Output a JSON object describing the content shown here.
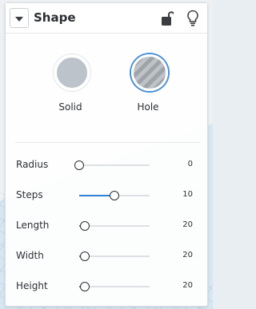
{
  "panel": {
    "title": "Shape",
    "icons": {
      "collapse": "chevron-down-icon",
      "lock": "unlock-icon",
      "bulb": "lightbulb-icon"
    }
  },
  "shape_types": [
    {
      "label": "Solid",
      "selected": false,
      "color": "#bcc3cb"
    },
    {
      "label": "Hole",
      "selected": true,
      "accent": "#4a8fd6"
    }
  ],
  "params": [
    {
      "label": "Radius",
      "value": "0",
      "fraction": 0.0
    },
    {
      "label": "Steps",
      "value": "10",
      "fraction": 0.5
    },
    {
      "label": "Length",
      "value": "20",
      "fraction": 0.08
    },
    {
      "label": "Width",
      "value": "20",
      "fraction": 0.08
    },
    {
      "label": "Height",
      "value": "20",
      "fraction": 0.08
    }
  ],
  "colors": {
    "slider_fill": "#2e80d9",
    "selected_ring": "#4a8fd6"
  }
}
